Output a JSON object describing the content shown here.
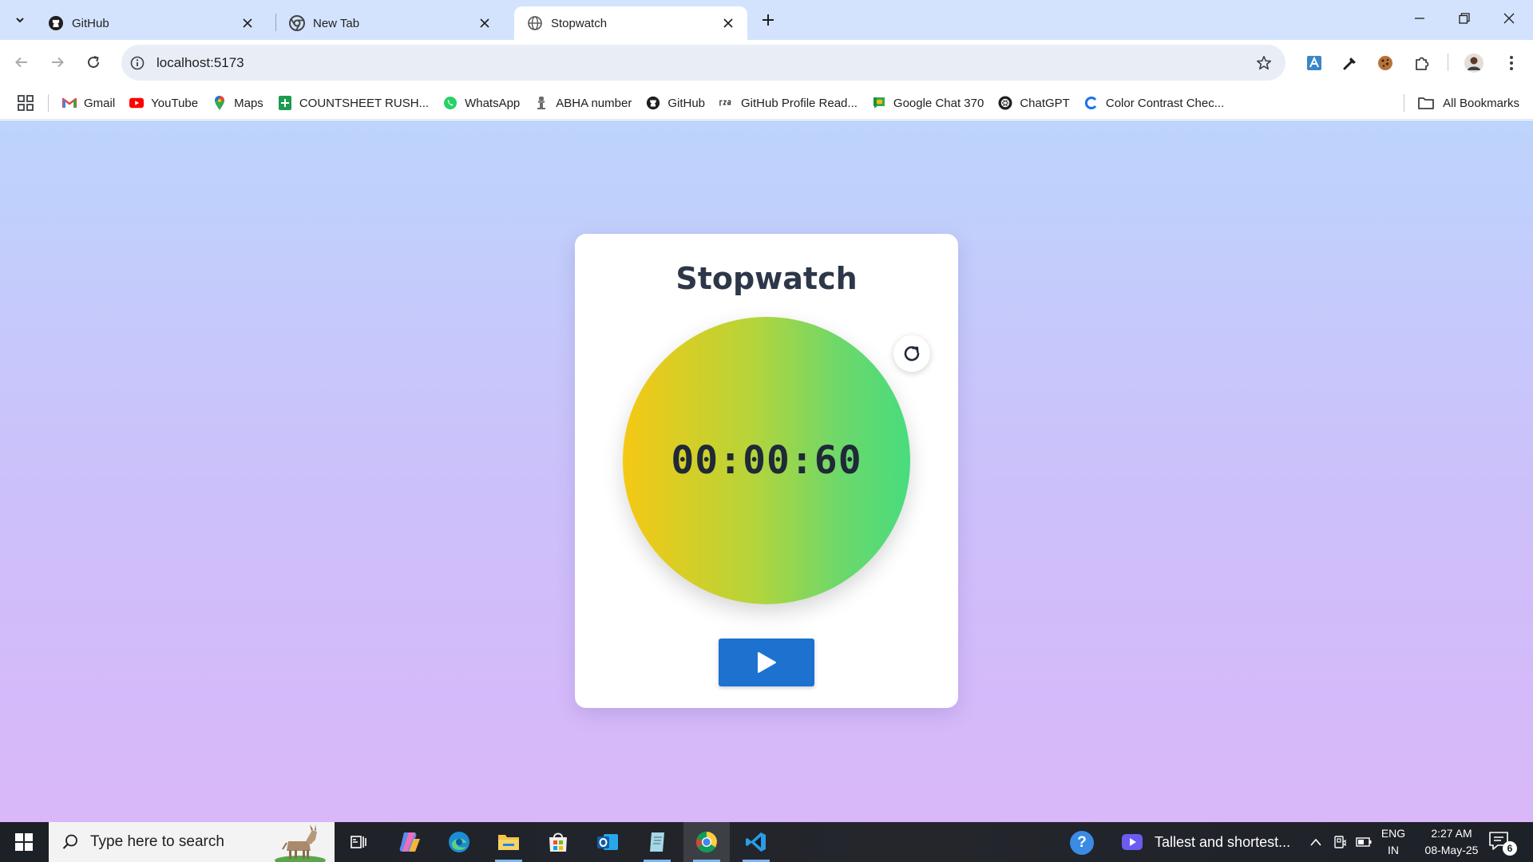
{
  "browser": {
    "tabs": [
      {
        "title": "GitHub",
        "favicon": "github-icon",
        "active": false
      },
      {
        "title": "New Tab",
        "favicon": "chrome-icon",
        "active": false
      },
      {
        "title": "Stopwatch",
        "favicon": "globe-icon",
        "active": true
      }
    ],
    "address_bar": {
      "url": "localhost:5173"
    },
    "bookmarks": [
      {
        "label": "Gmail",
        "icon": "gmail-icon"
      },
      {
        "label": "YouTube",
        "icon": "youtube-icon"
      },
      {
        "label": "Maps",
        "icon": "maps-icon"
      },
      {
        "label": "COUNTSHEET RUSH...",
        "icon": "sheets-icon"
      },
      {
        "label": "WhatsApp",
        "icon": "whatsapp-icon"
      },
      {
        "label": "ABHA number",
        "icon": "emblem-icon"
      },
      {
        "label": "GitHub",
        "icon": "github-icon"
      },
      {
        "label": "GitHub Profile Read...",
        "icon": "rsg-icon"
      },
      {
        "label": "Google Chat 370",
        "icon": "google-chat-icon"
      },
      {
        "label": "ChatGPT",
        "icon": "chatgpt-icon"
      },
      {
        "label": "Color Contrast Chec...",
        "icon": "contrast-checker-icon"
      }
    ],
    "all_bookmarks_label": "All Bookmarks"
  },
  "app": {
    "title": "Stopwatch",
    "time": "00:00:60",
    "reset_icon": "refresh-icon",
    "play_icon": "play-icon",
    "accent_color": "#1d72d0",
    "dial_gradient": [
      "#f5c814",
      "#48dc7e"
    ]
  },
  "taskbar": {
    "search_placeholder": "Type here to search",
    "news_text": "Tallest and shortest...",
    "language": [
      "ENG",
      "IN"
    ],
    "time": "2:27 AM",
    "date": "08-May-25",
    "notification_count": "6"
  }
}
